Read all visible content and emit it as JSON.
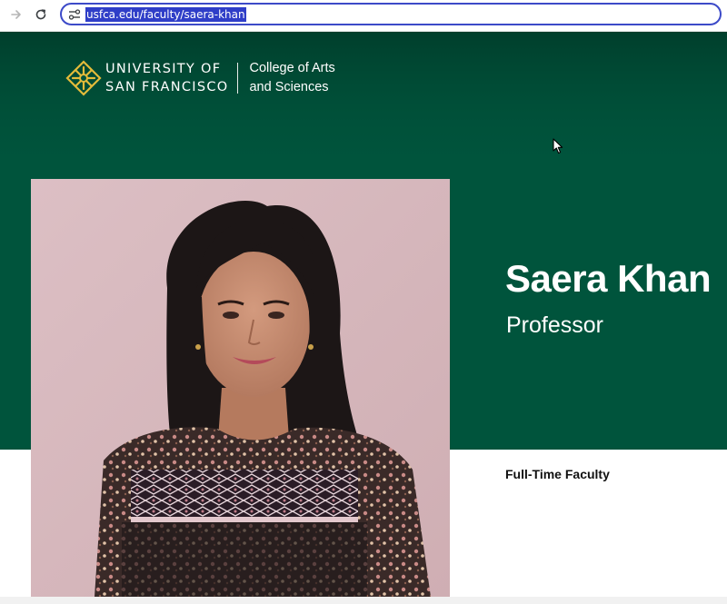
{
  "browser": {
    "url": "usfca.edu/faculty/saera-khan"
  },
  "site": {
    "logo_line1": "UNIVERSITY OF",
    "logo_line2": "SAN FRANCISCO",
    "college_line1": "College of Arts",
    "college_line2": "and Sciences"
  },
  "profile": {
    "name": "Saera Khan",
    "title": "Professor",
    "category": "Full-Time Faculty",
    "photo_icon": "faculty-portrait"
  },
  "colors": {
    "hero_green": "#00543c",
    "logo_gold": "#e3bb3a",
    "url_highlight": "#2f3ec8"
  }
}
